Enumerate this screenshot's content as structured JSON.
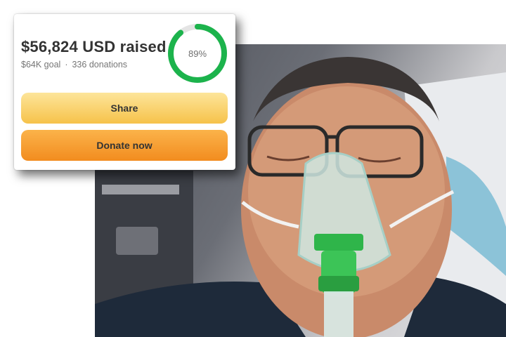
{
  "campaign": {
    "amount_raised": "$56,824 USD raised",
    "goal": "$64K goal",
    "separator": "·",
    "donations": "336 donations",
    "progress_label": "89%",
    "progress_fraction": 0.89
  },
  "buttons": {
    "share_label": "Share",
    "donate_label": "Donate now"
  },
  "colors": {
    "progress": "#1cb34c",
    "progress_track": "#e4e4e4",
    "share_button": "#f9d46a",
    "donate_button": "#f6a02e"
  },
  "icons": {
    "photo": "hospital-patient-oxygen-mask"
  }
}
